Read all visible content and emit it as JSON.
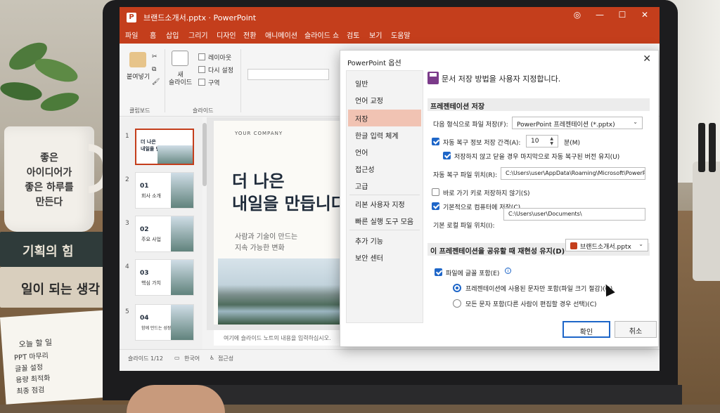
{
  "window": {
    "title": "브랜드소개서.pptx · PowerPoint",
    "app_icon": "P"
  },
  "menu": [
    "파일",
    "홈",
    "삽입",
    "그리기",
    "디자인",
    "전환",
    "애니메이션",
    "슬라이드 쇼",
    "검토",
    "보기",
    "도움말"
  ],
  "ribbon": {
    "paste": "붙여넣기",
    "new_slide": "새\n슬라이드",
    "layout": "레이아웃",
    "reset": "다시 설정",
    "section": "구역",
    "clipboard_group": "클립보드",
    "slides_group": "슬라이드"
  },
  "thumbnails": [
    {
      "num": "1",
      "title": "더 나은\n내일을 만듭니다",
      "sub": ""
    },
    {
      "num": "2",
      "title": "01",
      "sub": "회사 소개"
    },
    {
      "num": "3",
      "title": "02",
      "sub": "주요 사업"
    },
    {
      "num": "4",
      "title": "03",
      "sub": "핵심 가치"
    },
    {
      "num": "5",
      "title": "04",
      "sub": "함께 만드는 성장"
    }
  ],
  "slide": {
    "company": "YOUR COMPANY",
    "title": "더 나은\n내일을 만듭니다",
    "subtitle": "사람과 기술이 만드는\n지속 가능한 변화"
  },
  "notes_placeholder": "여기에 슬라이드 노트의 내용을 입력하십시오.",
  "status": {
    "slide_count": "슬라이드 1/12",
    "language": "한국어",
    "accessibility": "접근성"
  },
  "dialog": {
    "title": "PowerPoint 옵션",
    "nav": [
      "일반",
      "언어 교정",
      "저장",
      "한글 입력 체계",
      "언어",
      "접근성",
      "고급",
      "리본 사용자 지정",
      "빠른 실행 도구 모음",
      "추가 기능",
      "보안 센터"
    ],
    "selected_nav": "저장",
    "header": "문서 저장 방법을 사용자 지정합니다.",
    "section_save": "프레젠테이션 저장",
    "save_format_label": "다음 형식으로 파일 저장(F):",
    "save_format_value": "PowerPoint 프레젠테이션 (*.pptx)",
    "autorecover_label": "자동 복구 정보 저장 간격(A):",
    "autorecover_value": "10",
    "autorecover_unit": "분(M)",
    "keep_last_label": "저장하지 않고 닫을 경우 마지막으로 자동 복구된 버전 유지(U)",
    "autorecover_path_label": "자동 복구 파일 위치(R):",
    "autorecover_path_value": "C:\\Users\\user\\AppData\\Roaming\\Microsoft\\PowerPoint\\",
    "no_backstage_label": "바로 가기 키로 저장하지 않기(S)",
    "save_to_computer_label": "기본적으로 컴퓨터에 저장(C)",
    "local_path_label": "기본 로컬 파일 위치(I):",
    "local_path_value": "C:\\Users\\user\\Documents\\",
    "section_fidelity": "이 프레젠테이션을 공유할 때 재현성 유지(D)",
    "fidelity_file": "브랜드소개서.pptx",
    "embed_fonts_label": "파일에 글꼴 포함(E)",
    "radio_used_chars": "프레젠테이션에 사용된 문자만 포함(파일 크기 절감)(O)",
    "radio_all_chars": "모든 문자 포함(다른 사람이 편집할 경우 선택)(C)",
    "ok": "확인",
    "cancel": "취소"
  },
  "environment": {
    "mug_text": "좋은\n아이디어가\n좋은 하루를\n만든다",
    "book1": "기획의 힘",
    "book2": "일이 되는 생각",
    "notepad_title": "오늘 할 일",
    "notepad_items": [
      "PPT 마무리",
      "글꼴 설정",
      "용량 최적화",
      "최종 점검"
    ]
  },
  "colors": {
    "accent": "#c43e1c",
    "selection": "#1e66c8"
  }
}
